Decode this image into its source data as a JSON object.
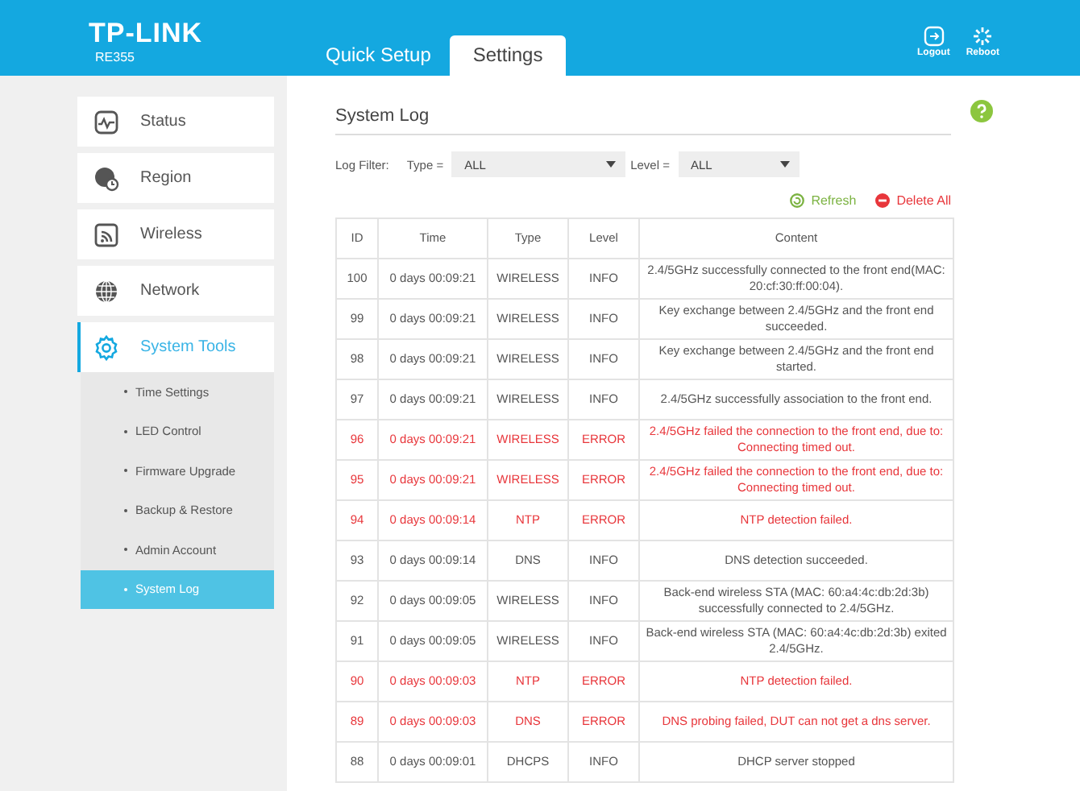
{
  "header": {
    "logo": "TP-LINK",
    "model": "RE355",
    "tabs": [
      {
        "label": "Quick Setup",
        "selected": false
      },
      {
        "label": "Settings",
        "selected": true
      }
    ],
    "actions": [
      {
        "kind": "logout",
        "label": "Logout"
      },
      {
        "kind": "reboot",
        "label": "Reboot"
      }
    ]
  },
  "sidebar": {
    "items": [
      {
        "kind": "status",
        "label": "Status",
        "selected": false
      },
      {
        "kind": "region",
        "label": "Region",
        "selected": false
      },
      {
        "kind": "wireless",
        "label": "Wireless",
        "selected": false
      },
      {
        "kind": "network",
        "label": "Network",
        "selected": false
      },
      {
        "kind": "tools",
        "label": "System Tools",
        "selected": true,
        "expanded": true,
        "children": [
          {
            "label": "Time Settings",
            "selected": false
          },
          {
            "label": "LED Control",
            "selected": false
          },
          {
            "label": "Firmware Upgrade",
            "selected": false
          },
          {
            "label": "Backup & Restore",
            "selected": false
          },
          {
            "label": "Admin Account",
            "selected": false
          },
          {
            "label": "System Log",
            "selected": true
          }
        ]
      }
    ]
  },
  "main": {
    "title": "System Log",
    "filter": {
      "label": "Log Filter:",
      "type_label": "Type =",
      "type_value": "ALL",
      "level_label": "Level =",
      "level_value": "ALL"
    },
    "actions": [
      {
        "kind": "refresh",
        "label": "Refresh"
      },
      {
        "kind": "delete",
        "label": "Delete All"
      }
    ],
    "table": {
      "columns": [
        "ID",
        "Time",
        "Type",
        "Level",
        "Content"
      ],
      "rows": [
        {
          "kind": "info",
          "cells": [
            "100",
            "0 days 00:09:21",
            "WIRELESS",
            "INFO",
            "2.4/5GHz successfully connected to the front end(MAC: 20:cf:30:ff:00:04)."
          ]
        },
        {
          "kind": "info",
          "cells": [
            "99",
            "0 days 00:09:21",
            "WIRELESS",
            "INFO",
            "Key exchange between 2.4/5GHz and the front end succeeded."
          ]
        },
        {
          "kind": "info",
          "cells": [
            "98",
            "0 days 00:09:21",
            "WIRELESS",
            "INFO",
            "Key exchange between 2.4/5GHz and the front end started."
          ]
        },
        {
          "kind": "info",
          "cells": [
            "97",
            "0 days 00:09:21",
            "WIRELESS",
            "INFO",
            "2.4/5GHz successfully association to the front end."
          ]
        },
        {
          "kind": "error",
          "cells": [
            "96",
            "0 days 00:09:21",
            "WIRELESS",
            "ERROR",
            "2.4/5GHz failed the connection to the front end, due to: Connecting timed out."
          ]
        },
        {
          "kind": "error",
          "cells": [
            "95",
            "0 days 00:09:21",
            "WIRELESS",
            "ERROR",
            "2.4/5GHz failed the connection to the front end, due to: Connecting timed out."
          ]
        },
        {
          "kind": "error",
          "cells": [
            "94",
            "0 days 00:09:14",
            "NTP",
            "ERROR",
            "NTP detection failed."
          ]
        },
        {
          "kind": "info",
          "cells": [
            "93",
            "0 days 00:09:14",
            "DNS",
            "INFO",
            "DNS detection succeeded."
          ]
        },
        {
          "kind": "info",
          "cells": [
            "92",
            "0 days 00:09:05",
            "WIRELESS",
            "INFO",
            "Back-end wireless STA (MAC: 60:a4:4c:db:2d:3b) successfully connected to 2.4/5GHz."
          ]
        },
        {
          "kind": "info",
          "cells": [
            "91",
            "0 days 00:09:05",
            "WIRELESS",
            "INFO",
            "Back-end wireless STA (MAC: 60:a4:4c:db:2d:3b) exited 2.4/5GHz."
          ]
        },
        {
          "kind": "error",
          "cells": [
            "90",
            "0 days 00:09:03",
            "NTP",
            "ERROR",
            "NTP detection failed."
          ]
        },
        {
          "kind": "error",
          "cells": [
            "89",
            "0 days 00:09:03",
            "DNS",
            "ERROR",
            "DNS probing failed, DUT can not get a dns server."
          ]
        },
        {
          "kind": "info",
          "cells": [
            "88",
            "0 days 00:09:01",
            "DHCPS",
            "INFO",
            "DHCP server stopped"
          ]
        }
      ]
    }
  }
}
